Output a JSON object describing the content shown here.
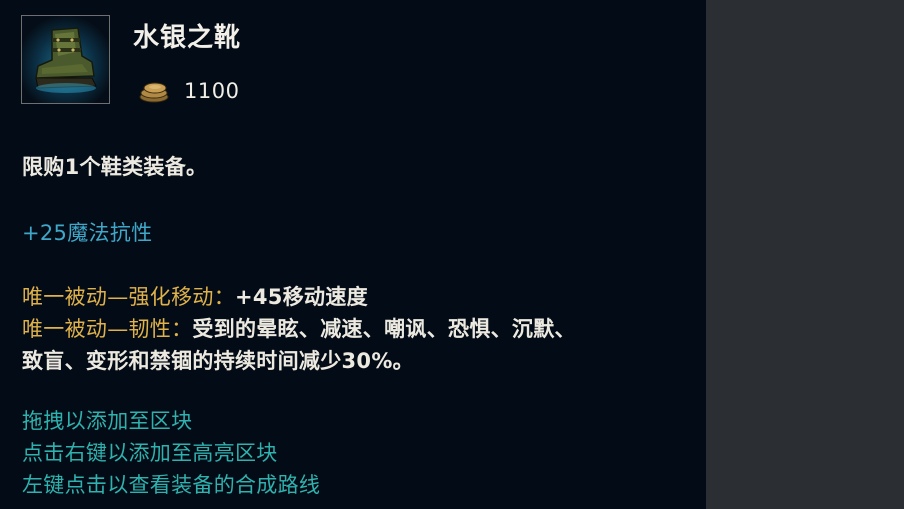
{
  "item": {
    "name": "水银之靴",
    "cost": "1100",
    "icon": "mercury-boots-icon"
  },
  "currency_icon": "gold-coins-icon",
  "description": {
    "limit": "限购1个鞋类装备。",
    "stat": "+25魔法抗性",
    "passive1": {
      "label": "唯一被动—强化移动：",
      "text": "+45移动速度"
    },
    "passive2": {
      "label": "唯一被动—韧性：",
      "text_line1": "受到的晕眩、减速、嘲讽、恐惧、沉默、",
      "text_line2": "致盲、变形和禁锢的持续时间减少30%。"
    }
  },
  "hints": [
    "拖拽以添加至区块",
    "点击右键以添加至高亮区块",
    "左键点击以查看装备的合成路线"
  ],
  "colors": {
    "background": "#030b16",
    "hint_teal": "#2fb2ad",
    "passive_gold": "#e0b24a",
    "stat_blue": "#3fa8c9"
  }
}
